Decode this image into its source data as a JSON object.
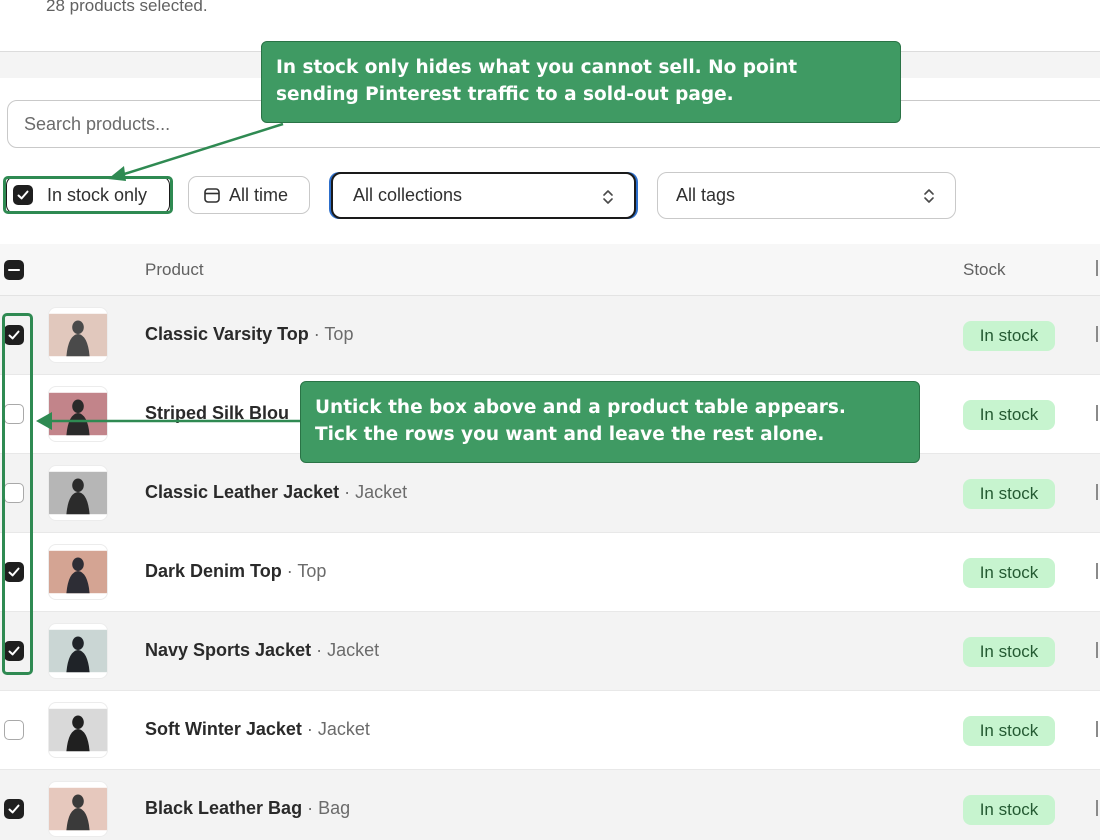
{
  "header": {
    "selected_count_text": "28 products selected."
  },
  "search": {
    "placeholder": "Search products..."
  },
  "filters": {
    "in_stock_label": "In stock only",
    "in_stock_checked": true,
    "time_label": "All time",
    "collections_value": "All collections",
    "tags_value": "All tags"
  },
  "table": {
    "columns": {
      "product": "Product",
      "stock": "Stock"
    },
    "rows": [
      {
        "name": "Classic Varsity Top",
        "type": "· Top",
        "stock": "In stock",
        "checked": true,
        "thumb_colors": [
          "#c99a86",
          "#4a4a4a"
        ]
      },
      {
        "name": "Striped Silk Blou",
        "type": "",
        "stock": "In stock",
        "checked": false,
        "thumb_colors": [
          "#8f1f2a",
          "#2a2a2a"
        ]
      },
      {
        "name": "Classic Leather Jacket",
        "type": "· Jacket",
        "stock": "In stock",
        "checked": false,
        "thumb_colors": [
          "#7a7a7a",
          "#2b2b2b"
        ]
      },
      {
        "name": "Dark Denim Top",
        "type": "· Top",
        "stock": "In stock",
        "checked": true,
        "thumb_colors": [
          "#b05a3a",
          "#2d2d35"
        ]
      },
      {
        "name": "Navy Sports Jacket",
        "type": "· Jacket",
        "stock": "In stock",
        "checked": true,
        "thumb_colors": [
          "#9fb5b0",
          "#1f2328"
        ]
      },
      {
        "name": "Soft Winter Jacket",
        "type": "· Jacket",
        "stock": "In stock",
        "checked": false,
        "thumb_colors": [
          "#b9b9b9",
          "#202020"
        ]
      },
      {
        "name": "Black Leather Bag",
        "type": "· Bag",
        "stock": "In stock",
        "checked": true,
        "thumb_colors": [
          "#d29a86",
          "#3a3a3a"
        ]
      }
    ]
  },
  "annotations": {
    "note_1_line_1": "In stock only hides what you cannot sell. No point",
    "note_1_line_2": "sending Pinterest traffic to a sold-out page.",
    "note_2_line_1": "Untick the box above and a product table appears.",
    "note_2_line_2": "Tick the rows you want and leave the rest alone.",
    "color": "#3f9a63"
  },
  "colors": {
    "badge_bg": "#c7f4cf",
    "badge_text": "#245a32",
    "focus_ring": "#2c6ecb"
  }
}
